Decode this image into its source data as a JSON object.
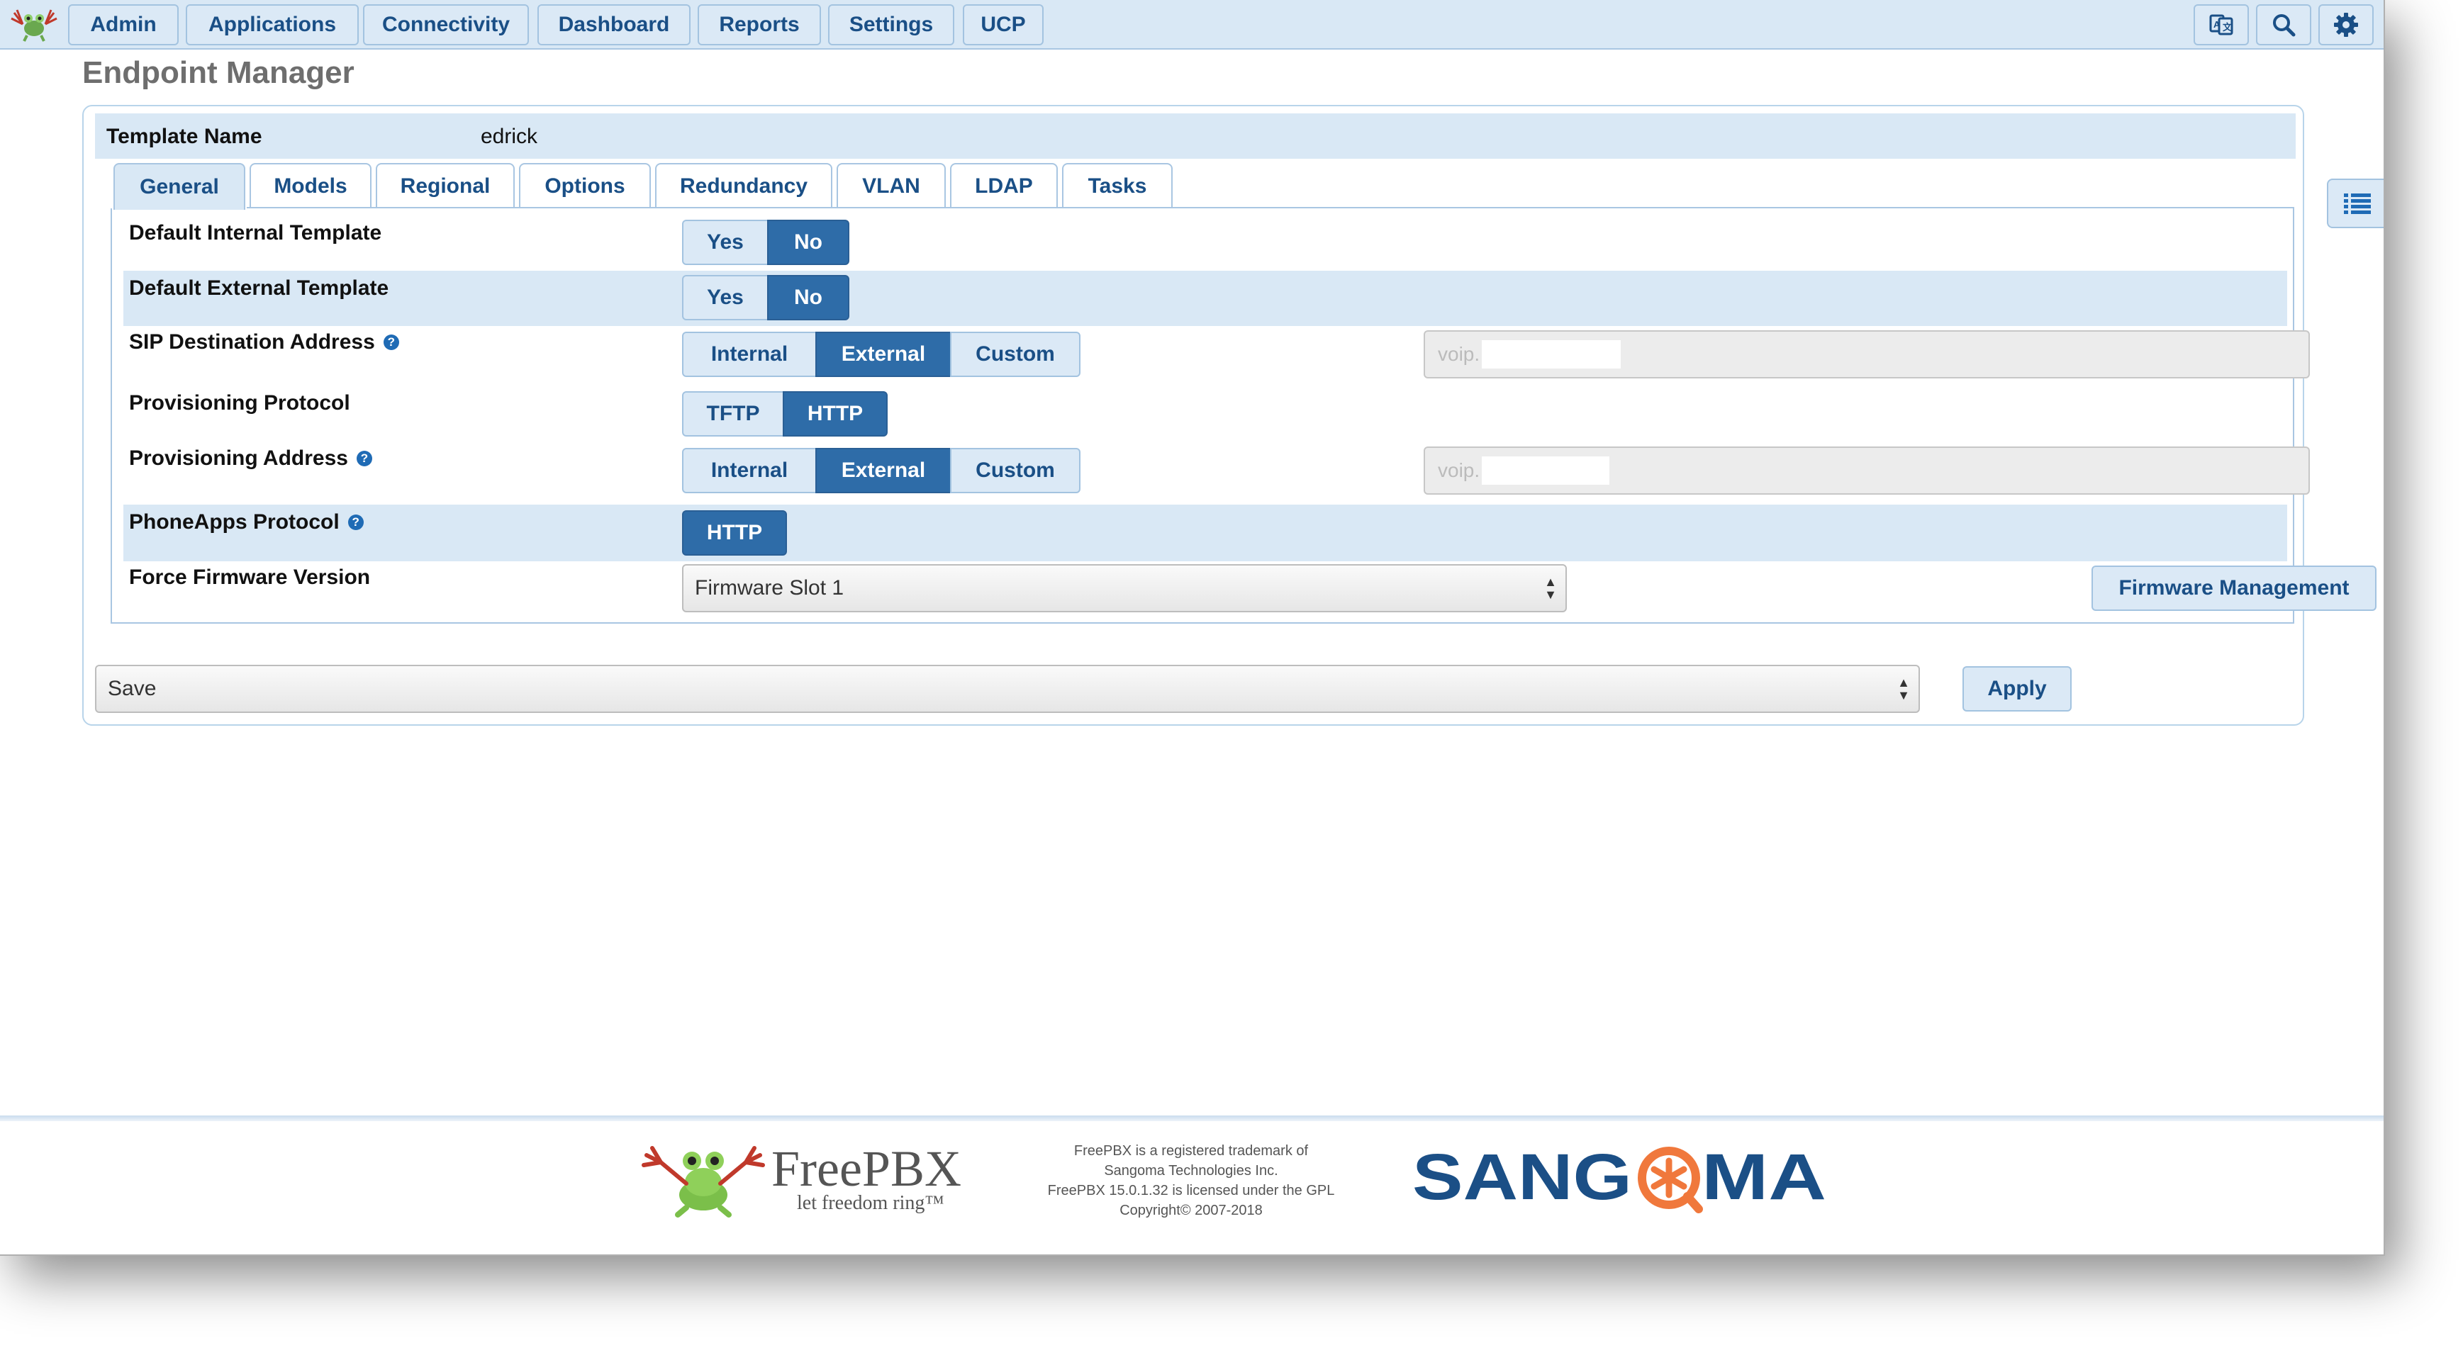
{
  "nav": {
    "items": [
      "Admin",
      "Applications",
      "Connectivity",
      "Dashboard",
      "Reports",
      "Settings",
      "UCP"
    ],
    "icons": [
      "translate-icon",
      "search-icon",
      "gear-icon"
    ]
  },
  "page": {
    "title": "Endpoint Manager"
  },
  "template": {
    "label": "Template Name",
    "value": "edrick"
  },
  "tabs": [
    "General",
    "Models",
    "Regional",
    "Options",
    "Redundancy",
    "VLAN",
    "LDAP",
    "Tasks"
  ],
  "active_tab": "General",
  "fields": {
    "default_internal": {
      "label": "Default Internal Template",
      "options": [
        "Yes",
        "No"
      ],
      "selected": "No"
    },
    "default_external": {
      "label": "Default External Template",
      "options": [
        "Yes",
        "No"
      ],
      "selected": "No"
    },
    "sip_destination": {
      "label": "SIP Destination Address",
      "options": [
        "Internal",
        "External",
        "Custom"
      ],
      "selected": "External",
      "input_value": "voip."
    },
    "prov_protocol": {
      "label": "Provisioning Protocol",
      "options": [
        "TFTP",
        "HTTP"
      ],
      "selected": "HTTP"
    },
    "prov_address": {
      "label": "Provisioning Address",
      "options": [
        "Internal",
        "External",
        "Custom"
      ],
      "selected": "External",
      "input_value": "voip."
    },
    "phoneapps_protocol": {
      "label": "PhoneApps Protocol",
      "options": [
        "HTTP"
      ],
      "selected": "HTTP"
    },
    "firmware": {
      "label": "Force Firmware Version",
      "selected": "Firmware Slot 1",
      "button": "Firmware Management"
    }
  },
  "actions": {
    "select_value": "Save",
    "apply_label": "Apply"
  },
  "footer": {
    "brand": "FreePBX",
    "tagline": "let freedom ring™",
    "legal": [
      "FreePBX is a registered trademark of",
      "Sangoma Technologies Inc.",
      "FreePBX 15.0.1.32 is licensed under the GPL",
      "Copyright© 2007-2018"
    ],
    "sangoma": "SANGOMA"
  },
  "colors": {
    "accent": "#2e6ca8",
    "light": "#dbe9f6",
    "text_blue": "#1a4f86",
    "sangoma_blue": "#1b4f86",
    "sangoma_orange": "#f0783c"
  }
}
